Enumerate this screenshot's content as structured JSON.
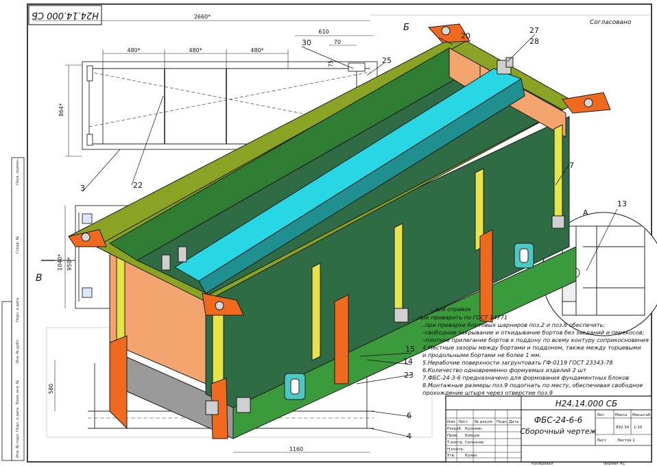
{
  "drawing": {
    "doc_code_rotated": "Н24.14.000 СБ",
    "approval_label": "Согласовано",
    "doc_code": "Н24.14.000 СБ",
    "product_name": "ФБС-24-6-6",
    "sheet_type": "Сборочный чертеж",
    "mass_value": "892.34",
    "scale_value": "1:10",
    "sheet_label": "Лист",
    "sheets_label": "Листов 1",
    "mass_header": "Масса",
    "scale_header": "Масштаб",
    "lit_header": "Лит.",
    "copied_label": "Копировал",
    "format_label": "Формат A1",
    "view_letter_b_top": "Б",
    "view_letter_b_left": "В",
    "view_letter_a": "А"
  },
  "dimensions": {
    "overall_length": "2660*",
    "span_480_1": "480*",
    "span_480_2": "480*",
    "span_480_3": "480*",
    "d610": "610",
    "d70": "70",
    "d75": "75",
    "height_864": "864*",
    "d1040": "1040*",
    "d950": "950*",
    "d580": "580",
    "d1160": "1160"
  },
  "callouts": {
    "c3": "3",
    "c22": "22",
    "c30": "30",
    "c25": "25",
    "c27": "27",
    "c28": "28",
    "c20": "20",
    "c7": "7",
    "c13": "13",
    "c15": "15",
    "c14": "14",
    "c23": "23",
    "c6": "6",
    "c4": "4"
  },
  "notes": {
    "n0": "...для справок",
    "n1": "...при приварить по ГОСТ 14771",
    "n2": "...при приварке бортовых шарниров поз.2 и поз.8 обеспечить:",
    "n3": "–свободное закрывание и откидывание бортов без заеданий и перекосов;",
    "n4": "–плотное прилегание бортов к поддону по всему контуру соприкосновения",
    "n5": "4.Местные зазоры между бортами и поддоном, также между торцевыми",
    "n6": "и продольными бортами не более 1 мм.",
    "n7": "5.Нерабочие поверхности загрунтовать ГФ-0119 ГОСТ 23343-78",
    "n8": "6.Количество одновременно формуемых изделий 2 шт",
    "n9": "7.ФБС-24-3-6 предназначено для формования фундаментных блоков",
    "n10": "8.Монтажные размеры поз.9 подогнать по месту, обеспечивая свободное",
    "n11": "прохождение штыря через отверстие поз.9"
  },
  "title_block": {
    "rows": [
      "Изм.",
      "Разраб.",
      "Пров.",
      "Т.контр.",
      "Н.контр.",
      "Утв."
    ],
    "col_sheet": "Лист",
    "col_doc": "№ докум.",
    "col_sign": "Подп.",
    "col_date": "Дата",
    "names": [
      "Кузьмин",
      "Бойцов",
      "Селезнев",
      "Кузин"
    ]
  },
  "side_strip": {
    "labels": [
      "Перв. примен.",
      "Справ. №",
      "Подп. и дата",
      "Инв. № дубл.",
      "Взам. инв. №",
      "Подп. и дата",
      "Инв. № подл."
    ]
  },
  "colors": {
    "frame_green": "#2e7d32",
    "panel_dark_green": "#2f6b45",
    "rim_olive": "#8aa324",
    "stiffener_yellow": "#e6e44a",
    "inner_peach": "#f4a46e",
    "center_divider_cyan": "#29d6e4",
    "bracket_orange": "#ef6a1e",
    "plate_teal": "#4dc9c4",
    "bottom_grey": "#9a9a9a",
    "outline": "#1a1a1a"
  }
}
